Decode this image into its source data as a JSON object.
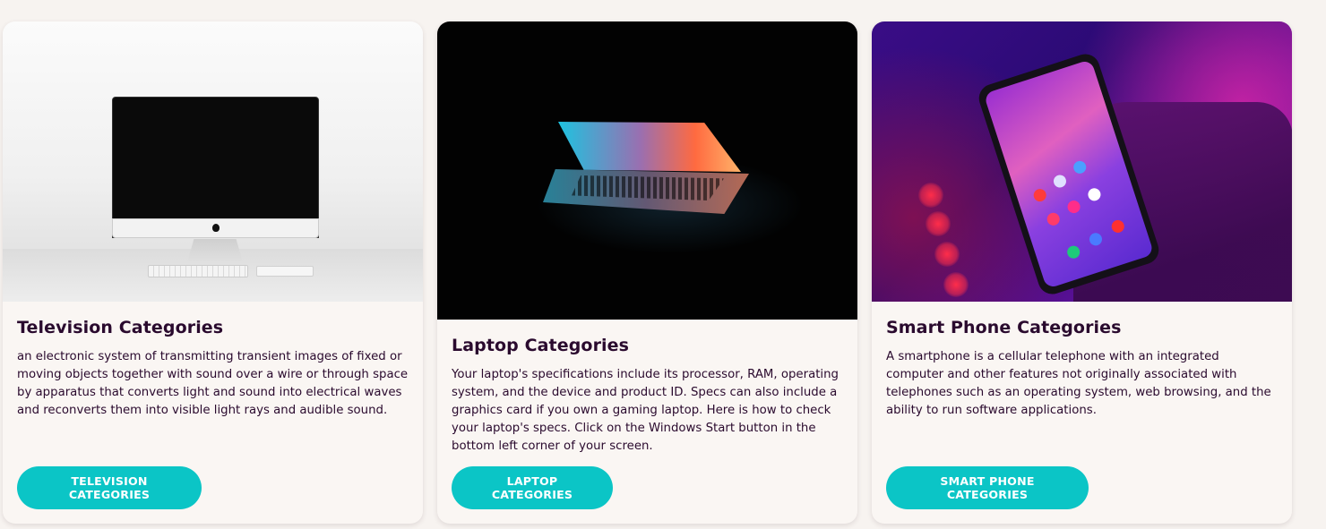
{
  "cards": [
    {
      "title": "Television Categories",
      "description": "an electronic system of transmitting transient images of fixed or moving objects together with sound over a wire or through space by apparatus that converts light and sound into electrical waves and reconverts them into visible light rays and audible sound.",
      "button_label": "TELEVISION CATEGORIES",
      "image_subject": "white desktop monitor with keyboard"
    },
    {
      "title": "Laptop Categories",
      "description": "Your laptop's specifications include its processor, RAM, operating system, and the device and product ID. Specs can also include a graphics card if you own a gaming laptop. Here is how to check your laptop's specs. Click on the Windows Start button in the bottom left corner of your screen.",
      "button_label": "LAPTOP CATEGORIES",
      "image_subject": "half-open laptop glowing in the dark"
    },
    {
      "title": "Smart Phone Categories",
      "description": "A smartphone is a cellular telephone with an integrated computer and other features not originally associated with telephones such as an operating system, web browsing, and the ability to run software applications.",
      "button_label": "SMART PHONE CATEGORIES",
      "image_subject": "hand holding a smartphone in purple neon light"
    }
  ],
  "colors": {
    "page_background": "#f7f3f0",
    "card_background": "#faf6f3",
    "title_text": "#2a0a2e",
    "button_background": "#0bc5c6",
    "button_text": "#ffffff"
  }
}
